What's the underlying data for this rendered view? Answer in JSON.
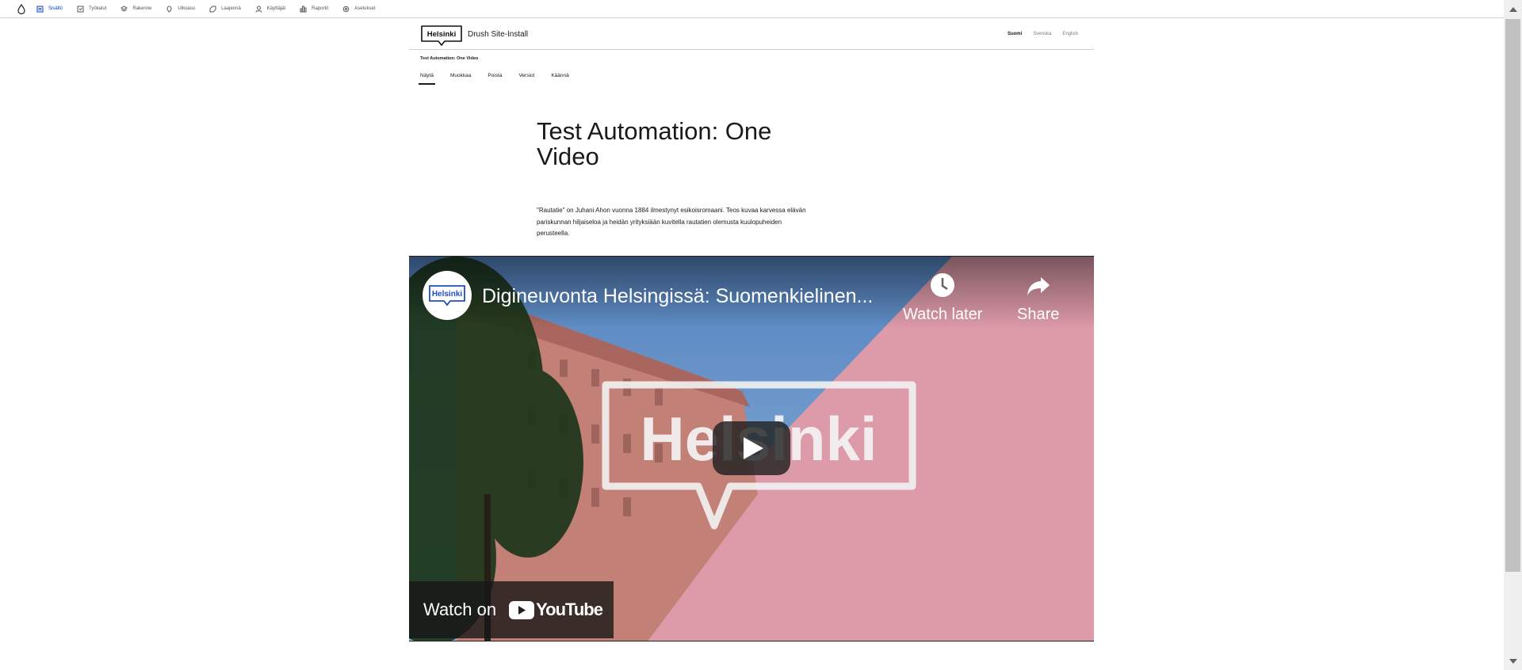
{
  "toolbar": {
    "items": [
      {
        "label": "Sisältö",
        "icon": "content-icon",
        "active": true
      },
      {
        "label": "Työkalut",
        "icon": "tools-icon"
      },
      {
        "label": "Rakenne",
        "icon": "structure-icon"
      },
      {
        "label": "Ulkoasu",
        "icon": "appearance-icon"
      },
      {
        "label": "Laajennä",
        "icon": "extend-icon"
      },
      {
        "label": "Käyttäjät",
        "icon": "people-icon"
      },
      {
        "label": "Raportit",
        "icon": "reports-icon"
      },
      {
        "label": "Asetukset",
        "icon": "config-icon"
      }
    ]
  },
  "header": {
    "logo_text": "Helsinki",
    "site_name": "Drush Site-Install",
    "languages": [
      "Suomi",
      "Svenska",
      "English"
    ]
  },
  "page": {
    "label": "Test Automation: One Video",
    "tabs": [
      "Näytä",
      "Muokkaa",
      "Poista",
      "Versiot",
      "Käännä"
    ],
    "title": "Test Automation: One Video",
    "lead": "\"Rautatie\" on Juhani Ahon vuonna 1884 ilmestynyt esikoisromaani. Teos kuvaa karvessa elävän pariskunnan hiljaiseloa ja heidän yrityksiään kuvitella rautatien olemusta kuulopuheiden perusteella."
  },
  "video": {
    "channel_logo_text": "Helsinki",
    "title": "Digineuvonta Helsingissä: Suomenkielinen...",
    "watch_later": "Watch later",
    "share": "Share",
    "watch_on": "Watch on",
    "youtube": "YouTube",
    "overlay_logo_text": "Helsinki",
    "colors": {
      "pink": "#f0a8b8",
      "sky": "#7fb6e8",
      "building": "#d98b80"
    }
  }
}
